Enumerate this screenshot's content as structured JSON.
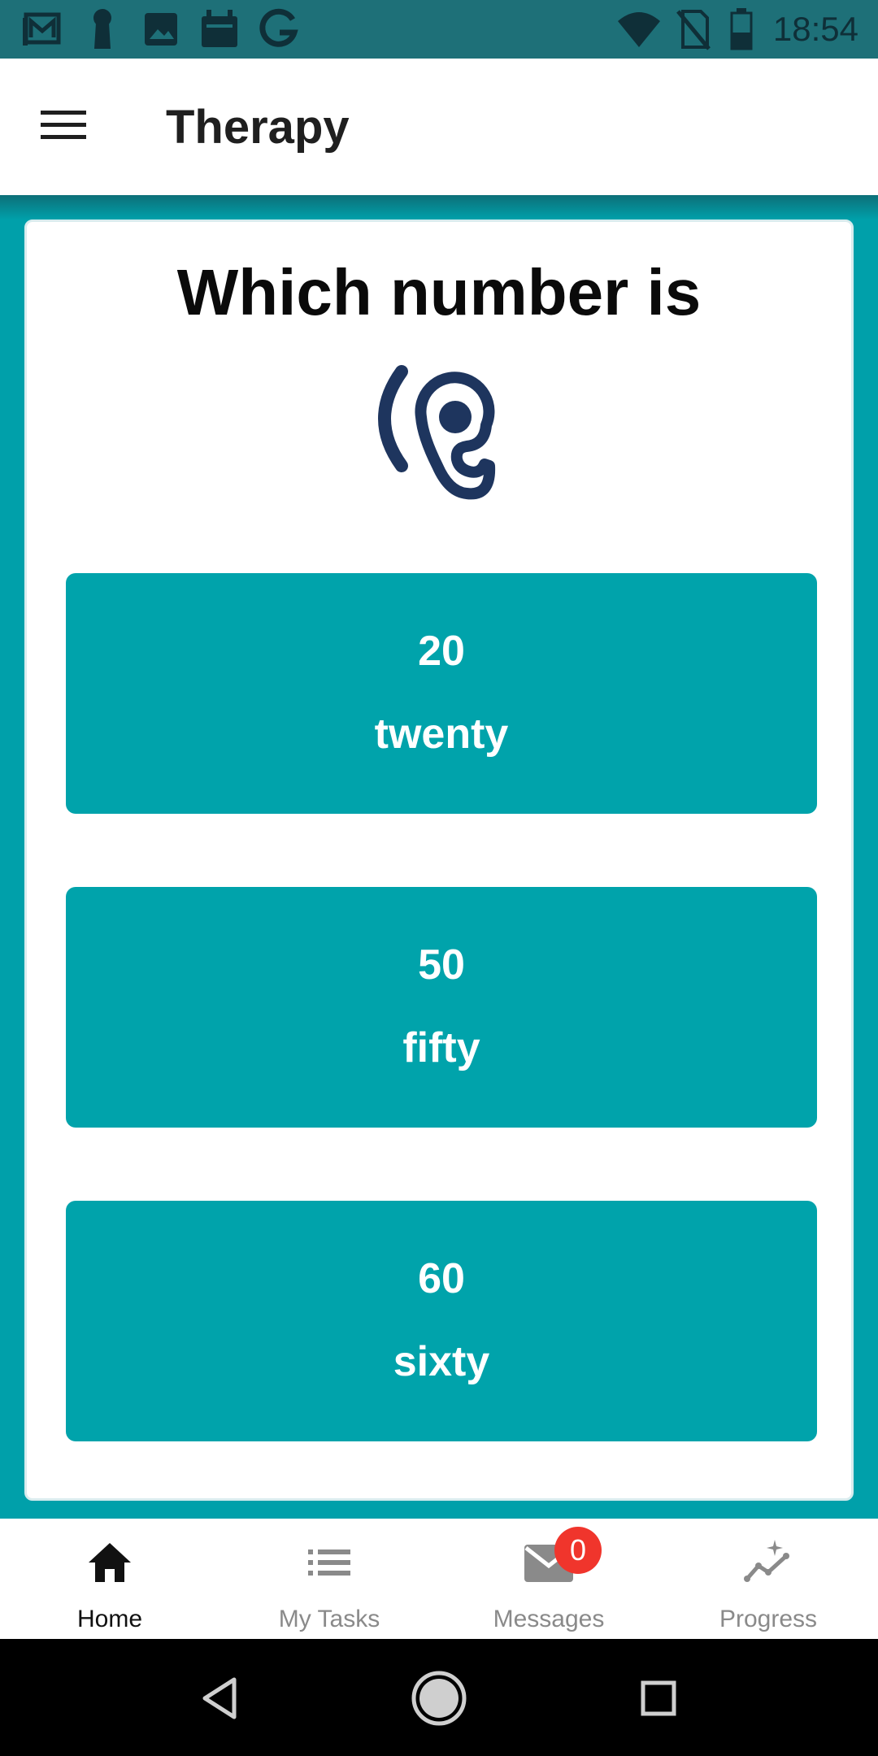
{
  "status_bar": {
    "time": "18:54",
    "left_icons": [
      "gmail-icon",
      "keyhole-icon",
      "image-icon",
      "calendar-icon",
      "google-icon"
    ],
    "right_icons": [
      "wifi-icon",
      "no-sim-icon",
      "battery-icon"
    ]
  },
  "app_bar": {
    "title": "Therapy",
    "menu_icon": "hamburger-menu-icon"
  },
  "question": {
    "text": "Which number is",
    "icon": "ear-listen-icon",
    "icon_color": "#1e355e"
  },
  "options": [
    {
      "number": "20",
      "word": "twenty"
    },
    {
      "number": "50",
      "word": "fifty"
    },
    {
      "number": "60",
      "word": "sixty"
    }
  ],
  "bottom_nav": {
    "items": [
      {
        "label": "Home",
        "icon": "home-icon",
        "active": true
      },
      {
        "label": "My Tasks",
        "icon": "list-icon",
        "active": false
      },
      {
        "label": "Messages",
        "icon": "mail-icon",
        "active": false
      },
      {
        "label": "Progress",
        "icon": "progress-chart-icon",
        "active": false
      }
    ],
    "messages_badge": "0"
  },
  "colors": {
    "status_bar": "#1e7078",
    "background": "#00a0aa",
    "option_button": "#00a3ab",
    "badge": "#f0352c",
    "active_nav": "#111111",
    "inactive_nav": "#8a8a8a"
  }
}
